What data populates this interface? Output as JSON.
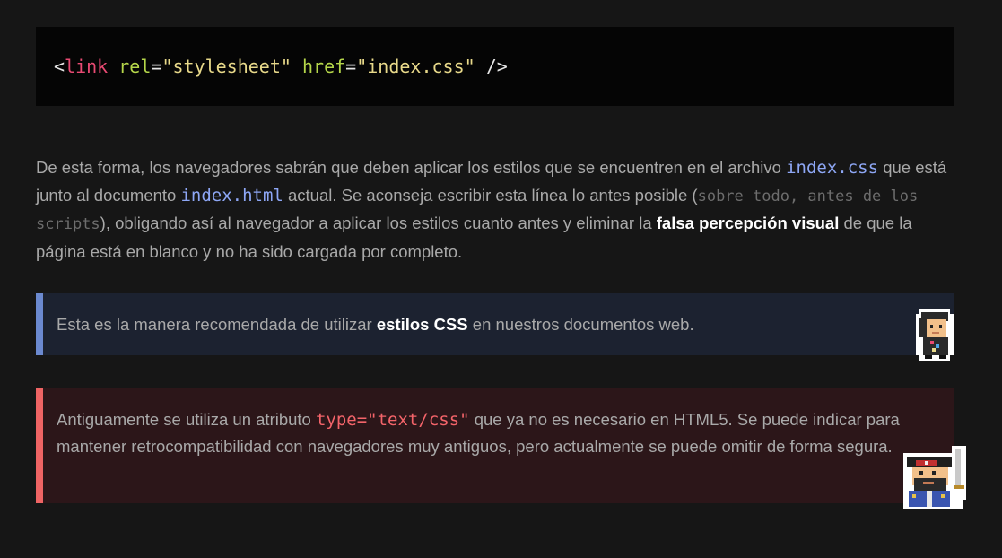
{
  "code": {
    "open": "<",
    "tag": "link",
    "attr1": "rel",
    "eq1": "=",
    "val1": "\"stylesheet\"",
    "attr2": "href",
    "eq2": "=",
    "val2": "\"index.css\"",
    "close": "/>"
  },
  "paragraph": {
    "t1": "De esta forma, los navegadores sabrán que deben aplicar los estilos que se encuentren en el archivo ",
    "code1": "index.css",
    "t2": " que está junto al documento ",
    "code2": "index.html",
    "t3": " actual. Se aconseja escribir esta línea lo antes posible (",
    "muted": "sobre todo, antes de los scripts",
    "t4": "), obligando así al navegador a aplicar los estilos cuanto antes y eliminar la ",
    "bold": "falsa percepción visual",
    "t5": " de que la página está en blanco y no ha sido cargada por completo."
  },
  "note": {
    "t1": "Esta es la manera recomendada de utilizar ",
    "bold": "estilos CSS",
    "t2": " en nuestros documentos web.",
    "avatar_icon": "pixel-character-avatar-icon",
    "accent": "#6b89cf"
  },
  "warning": {
    "t1": "Antiguamente se utiliza un atributo ",
    "code": "type=\"text/css\"",
    "t2": " que ya no es necesario en HTML5. Se puede indicar para mantener retrocompatibilidad con navegadores muy antiguos, pero actualmente se puede omitir de forma segura.",
    "avatar_icon": "pixel-pirate-avatar-icon",
    "accent": "#ef6464"
  }
}
